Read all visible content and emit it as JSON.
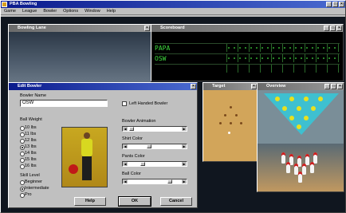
{
  "app": {
    "title": "PBA Bowling",
    "menu": [
      "Game",
      "League",
      "Bowler",
      "Options",
      "Window",
      "Help"
    ]
  },
  "lane_window": {
    "title": "Bowling Lane"
  },
  "score_window": {
    "title": "Scoreboard",
    "players": [
      "PAPA",
      "OSW"
    ]
  },
  "target_window": {
    "title": "Target"
  },
  "overview_window": {
    "title": "Overview"
  },
  "dialog": {
    "title": "Edit Bowler",
    "bowler_name_label": "Bowler Name",
    "bowler_name_value": "OSW",
    "left_handed_label": "Left Handed Bowler",
    "ball_weight_label": "Ball Weight",
    "weights": [
      "10 lbs",
      "11 lbs",
      "12 lbs",
      "13 lbs",
      "14 lbs",
      "15 lbs",
      "16 lbs"
    ],
    "selected_weight_index": 3,
    "skill_level_label": "Skill Level",
    "skill_levels": [
      "Beginner",
      "Intermediate",
      "Pro"
    ],
    "selected_skill_index": 1,
    "animation_label": "Bowler Animation",
    "shirt_label": "Shirt Color",
    "pants_label": "Pants Color",
    "ball_color_label": "Ball Color",
    "help_label": "Help",
    "ok_label": "OK",
    "cancel_label": "Cancel"
  },
  "colors": {
    "title_active": "#0a1a8c",
    "score_text": "#3fdc3f",
    "lane_triangle": "#3ec0d0"
  }
}
